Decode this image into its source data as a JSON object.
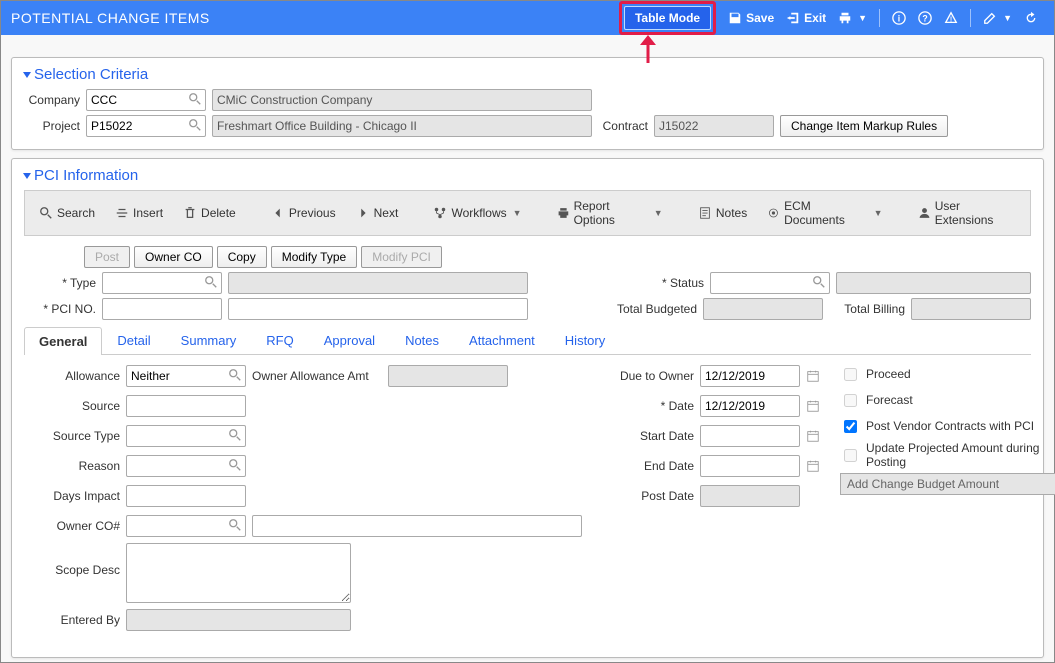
{
  "header": {
    "title": "POTENTIAL CHANGE ITEMS",
    "tableMode": "Table Mode",
    "save": "Save",
    "exit": "Exit"
  },
  "arrow": {
    "color": "#e11d48"
  },
  "selection": {
    "title": "Selection Criteria",
    "company": {
      "label": "Company",
      "code": "CCC",
      "name": "CMiC Construction Company"
    },
    "project": {
      "label": "Project",
      "code": "P15022",
      "name": "Freshmart Office Building - Chicago II"
    },
    "contract": {
      "label": "Contract",
      "code": "J15022"
    },
    "markupBtn": "Change Item Markup Rules"
  },
  "pci": {
    "title": "PCI Information",
    "toolbar": {
      "search": "Search",
      "insert": "Insert",
      "delete": "Delete",
      "previous": "Previous",
      "next": "Next",
      "workflows": "Workflows",
      "report": "Report Options",
      "notes": "Notes",
      "ecm": "ECM Documents",
      "userext": "User Extensions"
    },
    "actions": {
      "post": "Post",
      "ownerco": "Owner CO",
      "copy": "Copy",
      "modtype": "Modify Type",
      "modpci": "Modify PCI"
    },
    "fields": {
      "type": "Type",
      "pcino": "PCI NO.",
      "status": "Status",
      "totalBudgeted": "Total Budgeted",
      "totalBilling": "Total Billing"
    },
    "tabs": [
      "General",
      "Detail",
      "Summary",
      "RFQ",
      "Approval",
      "Notes",
      "Attachment",
      "History"
    ],
    "general": {
      "allowance": {
        "label": "Allowance",
        "value": "Neither"
      },
      "ownerAllowAmt": "Owner Allowance Amt",
      "source": "Source",
      "sourceType": "Source Type",
      "reason": "Reason",
      "daysImpact": "Days Impact",
      "ownerCONum": "Owner CO#",
      "scopeDesc": "Scope Desc",
      "enteredBy": "Entered By",
      "dueToOwner": {
        "label": "Due to Owner",
        "value": "12/12/2019"
      },
      "date": {
        "label": "Date",
        "value": "12/12/2019"
      },
      "startDate": "Start Date",
      "endDate": "End Date",
      "postDate": "Post Date",
      "checks": {
        "proceed": "Proceed",
        "forecast": "Forecast",
        "postVendor": "Post Vendor Contracts with PCI",
        "updateProjected": "Update Projected Amount during Posting"
      },
      "addBudget": "Add Change Budget Amount"
    }
  }
}
